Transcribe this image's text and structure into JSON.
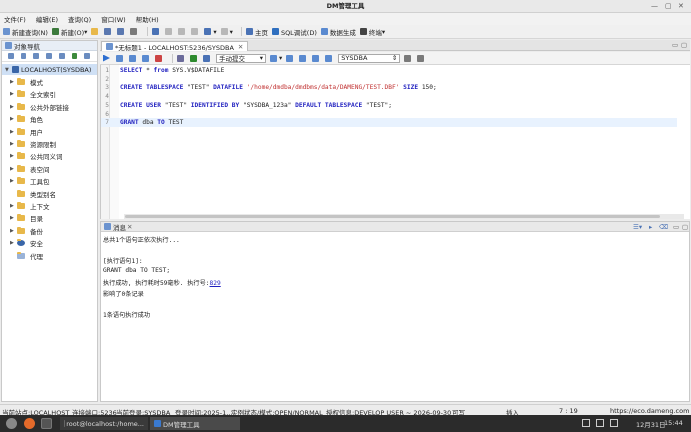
{
  "window": {
    "title": "DM管理工具"
  },
  "menu": [
    "文件(F)",
    "编辑(E)",
    "查询(Q)",
    "窗口(W)",
    "帮助(H)"
  ],
  "toolbar": {
    "new_query": "新建查询(N)",
    "new": "新建(O)",
    "home": "主页",
    "sql_debug": "SQL调试(D)",
    "data_gen": "数据生成",
    "terminal": "终端"
  },
  "nav": {
    "title": "对象导航",
    "root": "LOCALHOST(SYSDBA)",
    "items": [
      {
        "label": "模式",
        "arrow": true
      },
      {
        "label": "全文索引",
        "arrow": true
      },
      {
        "label": "公共外部链接",
        "arrow": true
      },
      {
        "label": "角色",
        "arrow": true
      },
      {
        "label": "用户",
        "arrow": true
      },
      {
        "label": "资源限制",
        "arrow": true
      },
      {
        "label": "公共同义词",
        "arrow": true
      },
      {
        "label": "表空间",
        "arrow": true
      },
      {
        "label": "工具包",
        "arrow": true
      },
      {
        "label": "类型别名",
        "arrow": false
      },
      {
        "label": "上下文",
        "arrow": true
      },
      {
        "label": "目录",
        "arrow": true
      },
      {
        "label": "备份",
        "arrow": true
      },
      {
        "label": "安全",
        "arrow": true
      },
      {
        "label": "代理",
        "arrow": false
      }
    ]
  },
  "editor": {
    "tab": "*无标题1 - LOCALHOST:5236/SYSDBA",
    "commit_mode": "手动提交",
    "schema": "SYSDBA",
    "lines": [
      {
        "n": "1",
        "parts": [
          [
            "kw",
            "SELECT"
          ],
          [
            "",
            "* "
          ],
          [
            "kw",
            "from"
          ],
          [
            "",
            "SYS.V$DATAFILE"
          ]
        ]
      },
      {
        "n": "2",
        "parts": []
      },
      {
        "n": "3",
        "parts": [
          [
            "kw",
            "CREATE TABLESPACE"
          ],
          [
            "",
            "\"TEST\" "
          ],
          [
            "kw",
            "DATAFILE"
          ],
          [
            "str",
            "'/home/dmdba/dmdbms/data/DAMENG/TEST.DBF'"
          ],
          [
            "kw",
            "SIZE"
          ],
          [
            "",
            "150;"
          ]
        ]
      },
      {
        "n": "4",
        "parts": []
      },
      {
        "n": "5",
        "parts": [
          [
            "kw",
            "CREATE USER"
          ],
          [
            "",
            "\"TEST\" "
          ],
          [
            "kw",
            "IDENTIFIED BY"
          ],
          [
            "",
            "\"SYSDBA_123a\" "
          ],
          [
            "kw",
            "DEFAULT TABLESPACE"
          ],
          [
            "",
            "\"TEST\";"
          ]
        ]
      },
      {
        "n": "6",
        "parts": []
      },
      {
        "n": "7",
        "parts": [
          [
            "kw",
            "GRANT"
          ],
          [
            "",
            "dba "
          ],
          [
            "kw",
            "TO"
          ],
          [
            "",
            "TEST"
          ]
        ]
      }
    ]
  },
  "messages": {
    "title": "消息",
    "lines": [
      "总共1个语句正依次执行...",
      "",
      "[执行语句1]:",
      "GRANT dba TO TEST;",
      "执行成功, 执行耗时59毫秒. 执行号:829",
      "影响了0条记录",
      "",
      "1条语句执行成功"
    ]
  },
  "status": {
    "site": "当前站点:LOCALHOST",
    "port": "连接端口:5236",
    "login": "当前登录:SYSDBA",
    "login_time": "登录时间:2025-1...",
    "instance": "实例状态/模式:OPEN/NORMAL",
    "license": "授权信息:DEVELOP USER ~ 2026-09-30",
    "writable": "可写",
    "insert": "插入",
    "cursor": "7 : 19",
    "url": "https://eco.dameng.com"
  },
  "taskbar": {
    "terminal": "root@localhost:/home...",
    "app": "DM管理工具",
    "date": "12月31日",
    "time": "15:44"
  },
  "colors": {
    "accent": "#1f1fbf",
    "string": "#c03030",
    "selection": "#cfe0f5"
  }
}
